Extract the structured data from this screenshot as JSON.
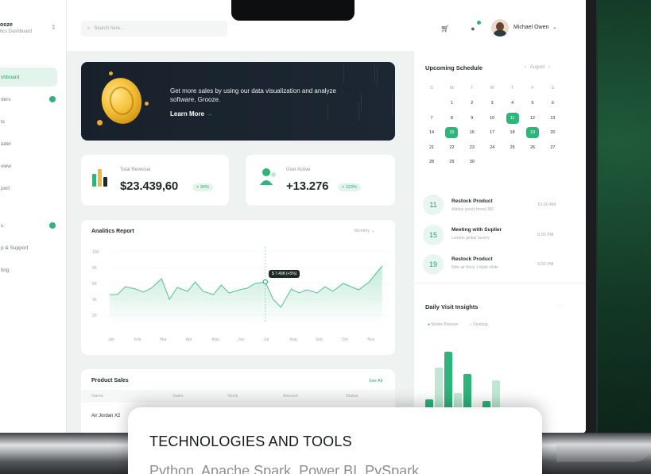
{
  "sidebar": {
    "brand_name": "ooze",
    "brand_sub": "tics Dashboard",
    "items": [
      {
        "label": "shboard",
        "active": true
      },
      {
        "label": "ders",
        "badge": true
      },
      {
        "label": "ts"
      },
      {
        "label": "ader"
      },
      {
        "label": "view"
      },
      {
        "label": "port"
      },
      {
        "label": "s",
        "badge": true
      },
      {
        "label": "p & Support"
      },
      {
        "label": "ting"
      }
    ]
  },
  "topbar": {
    "search_placeholder": "Search here...",
    "user_name": "Michael Owen"
  },
  "promo": {
    "text": "Get more sales by using our data visualization and analyze software, Grooze.",
    "link": "Learn More",
    "link_arrow": "→"
  },
  "stats": [
    {
      "label": "Total Revenue",
      "value": "$23.439,60",
      "badge": "+ 34%"
    },
    {
      "label": "User Active",
      "value": "+13.276",
      "badge": "+ 123%"
    }
  ],
  "analytics": {
    "title": "Analitics Report",
    "filter": "Monthly",
    "tooltip": "$ 7.498 (+5%)"
  },
  "chart_data": {
    "type": "area",
    "categories": [
      "Jan",
      "Feb",
      "Mar",
      "Apr",
      "May",
      "Jun",
      "Jul",
      "Aug",
      "Sep",
      "Oct",
      "Nov"
    ],
    "y_ticks": [
      "100",
      "80",
      "60",
      "40",
      "20"
    ],
    "ylim": [
      10,
      100
    ],
    "x": [
      0,
      0.3,
      0.6,
      1,
      1.3,
      1.6,
      2,
      2.3,
      2.6,
      3,
      3.3,
      3.6,
      4,
      4.3,
      4.6,
      5,
      5.3,
      5.6,
      6,
      6.3,
      6.6,
      7,
      7.3,
      7.6,
      8,
      8.3,
      8.6,
      9,
      9.3,
      9.6,
      10,
      10.5
    ],
    "values": [
      46,
      46,
      56,
      53,
      49,
      54,
      66,
      40,
      55,
      50,
      62,
      50,
      46,
      58,
      48,
      52,
      54,
      60,
      62,
      40,
      30,
      53,
      48,
      52,
      48,
      56,
      50,
      60,
      56,
      52,
      62,
      82
    ],
    "grid": true,
    "legend": "none"
  },
  "product_sales": {
    "title": "Product Sales",
    "see_all": "See All",
    "columns": [
      "Name",
      "Sales",
      "Stock",
      "Amount",
      "Status"
    ],
    "rows": [
      [
        "Air Jordan X2"
      ]
    ]
  },
  "schedule": {
    "title": "Upcoming Schedule",
    "month": "August",
    "weekdays": [
      "S",
      "M",
      "T",
      "W",
      "T",
      "F",
      "S"
    ],
    "weeks": [
      [
        "",
        "1",
        "2",
        "3",
        "4",
        "5",
        "6"
      ],
      [
        "7",
        "8",
        "9",
        "10",
        "11",
        "12",
        "13"
      ],
      [
        "14",
        "15",
        "16",
        "17",
        "18",
        "19",
        "20"
      ],
      [
        "21",
        "22",
        "23",
        "24",
        "25",
        "26",
        "27"
      ],
      [
        "28",
        "29",
        "30",
        "",
        "",
        "",
        ""
      ]
    ],
    "selected_days": [
      "11",
      "15",
      "19"
    ],
    "events": [
      {
        "day": "11",
        "title": "Restock Product",
        "sub": "Adidas yeezy boost 350",
        "time": "10.00 AM"
      },
      {
        "day": "15",
        "title": "Meeting with Suplier",
        "sub": "London global factory",
        "time": "8.00 PM"
      },
      {
        "day": "19",
        "title": "Restock Product",
        "sub": "Nike air force 1 triple white",
        "time": "9.00 PM"
      }
    ]
  },
  "visits": {
    "title": "Daily Visit Insights",
    "legend": [
      "Mobile Browser",
      "Desktop"
    ],
    "bars": [
      {
        "mobile": 0.35,
        "desktop": 0.68
      },
      {
        "mobile": 0.85,
        "desktop": 0.42
      },
      {
        "mobile": 0.62,
        "desktop": 0.25
      },
      {
        "mobile": 0.33,
        "desktop": 0.55
      }
    ]
  },
  "overlay": {
    "title": "TECHNOLOGIES AND TOOLS",
    "subtitle": "Python, Apache Spark, Power BI, PySpark"
  },
  "colors": {
    "accent": "#2db57a",
    "dark": "#18212b",
    "light_accent": "#bfe8d4"
  }
}
